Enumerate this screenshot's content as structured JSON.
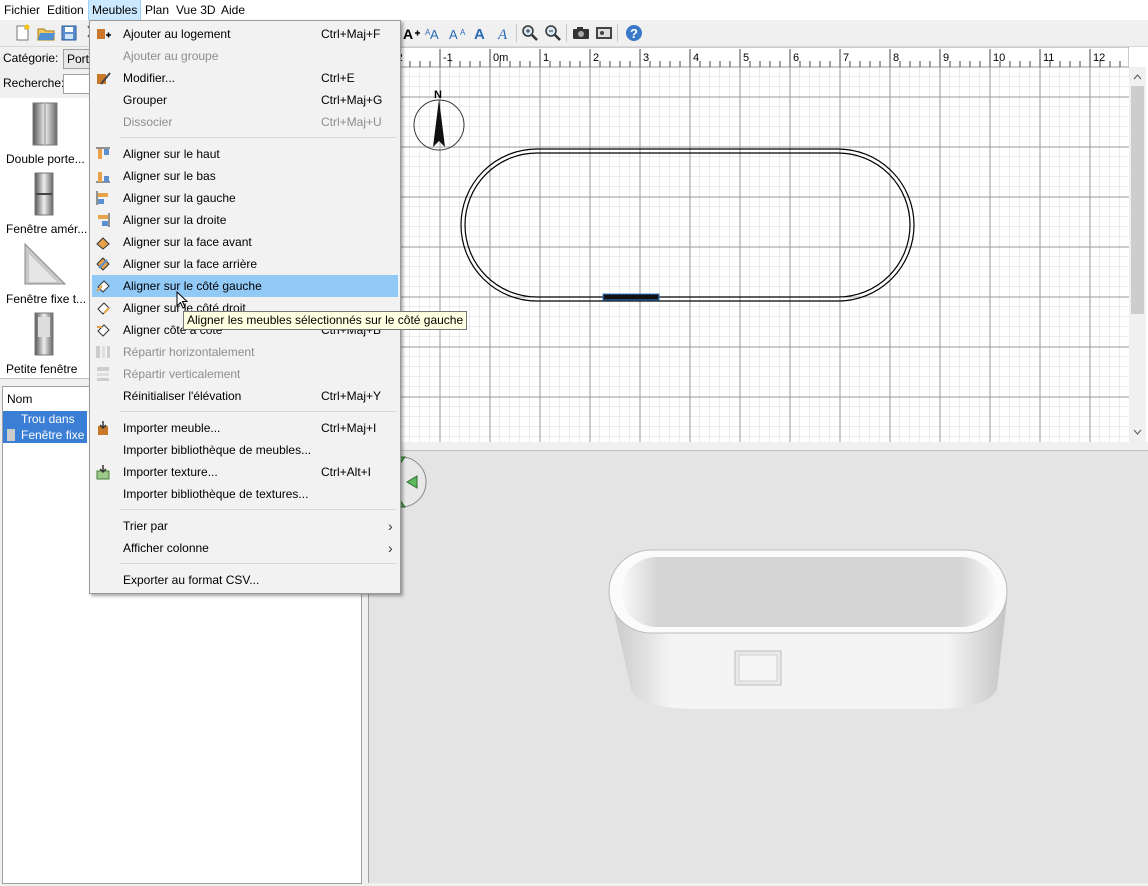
{
  "menubar": {
    "items": [
      "Fichier",
      "Edition",
      "Meubles",
      "Plan",
      "Vue 3D",
      "Aide"
    ],
    "active": "Meubles"
  },
  "left": {
    "category_label": "Catégorie:",
    "category_value": "Porte",
    "search_label": "Recherche:",
    "search_value": "",
    "catalog_items": [
      "Double porte...",
      "Fenêtre amér...",
      "Fenêtre fixe t...",
      "Petite fenêtre"
    ],
    "table_header": "Nom",
    "table_rows": [
      "Trou dans le m",
      "Fenêtre fixe"
    ]
  },
  "plan": {
    "ruler_labels": [
      "-2",
      "-1",
      "0m",
      "1",
      "2",
      "3",
      "4",
      "5",
      "6",
      "7",
      "8",
      "9",
      "10",
      "11",
      "12"
    ],
    "compass_label": "N"
  },
  "menu": {
    "items": [
      {
        "label": "Ajouter au logement",
        "accel": "Ctrl+Maj+F",
        "icon": "add-furniture-icon"
      },
      {
        "label": "Ajouter au groupe",
        "accel": "",
        "disabled": true
      },
      {
        "label": "Modifier...",
        "accel": "Ctrl+E",
        "icon": "modify-furniture-icon"
      },
      {
        "label": "Grouper",
        "accel": "Ctrl+Maj+G"
      },
      {
        "label": "Dissocier",
        "accel": "Ctrl+Maj+U",
        "disabled": true
      },
      {
        "label": "Aligner sur le haut",
        "accel": "",
        "icon": "align-top-icon"
      },
      {
        "label": "Aligner sur le bas",
        "accel": "",
        "icon": "align-bottom-icon"
      },
      {
        "label": "Aligner sur la gauche",
        "accel": "",
        "icon": "align-left-icon"
      },
      {
        "label": "Aligner sur la droite",
        "accel": "",
        "icon": "align-right-icon"
      },
      {
        "label": "Aligner sur la face avant",
        "accel": "",
        "icon": "align-front-icon"
      },
      {
        "label": "Aligner sur la face arrière",
        "accel": "",
        "icon": "align-back-icon"
      },
      {
        "label": "Aligner sur le côté gauche",
        "accel": "",
        "icon": "align-left-side-icon",
        "highlighted": true
      },
      {
        "label": "Aligner sur le côté droit",
        "accel": "",
        "icon": "align-right-side-icon"
      },
      {
        "label": "Aligner côte à côte",
        "accel": "Ctrl+Maj+B",
        "icon": "align-side-by-side-icon"
      },
      {
        "label": "Répartir horizontalement",
        "accel": "",
        "disabled": true,
        "icon": "distribute-horizontal-icon"
      },
      {
        "label": "Répartir verticalement",
        "accel": "",
        "disabled": true,
        "icon": "distribute-vertical-icon"
      },
      {
        "label": "Réinitialiser l'élévation",
        "accel": "Ctrl+Maj+Y"
      },
      {
        "label": "Importer meuble...",
        "accel": "Ctrl+Maj+I",
        "icon": "import-furniture-icon"
      },
      {
        "label": "Importer bibliothèque de meubles...",
        "accel": ""
      },
      {
        "label": "Importer texture...",
        "accel": "Ctrl+Alt+I",
        "icon": "import-texture-icon"
      },
      {
        "label": "Importer bibliothèque de textures...",
        "accel": ""
      },
      {
        "label": "Trier par",
        "accel": "",
        "submenu": true
      },
      {
        "label": "Afficher colonne",
        "accel": "",
        "submenu": true
      },
      {
        "label": "Exporter au format CSV...",
        "accel": ""
      }
    ]
  },
  "tooltip": "Aligner les meubles sélectionnés sur le côté gauche",
  "colors": {
    "menu_highlight": "#91c9f7",
    "selection": "#3a7fd5",
    "menubar_active": "#cce8ff"
  }
}
